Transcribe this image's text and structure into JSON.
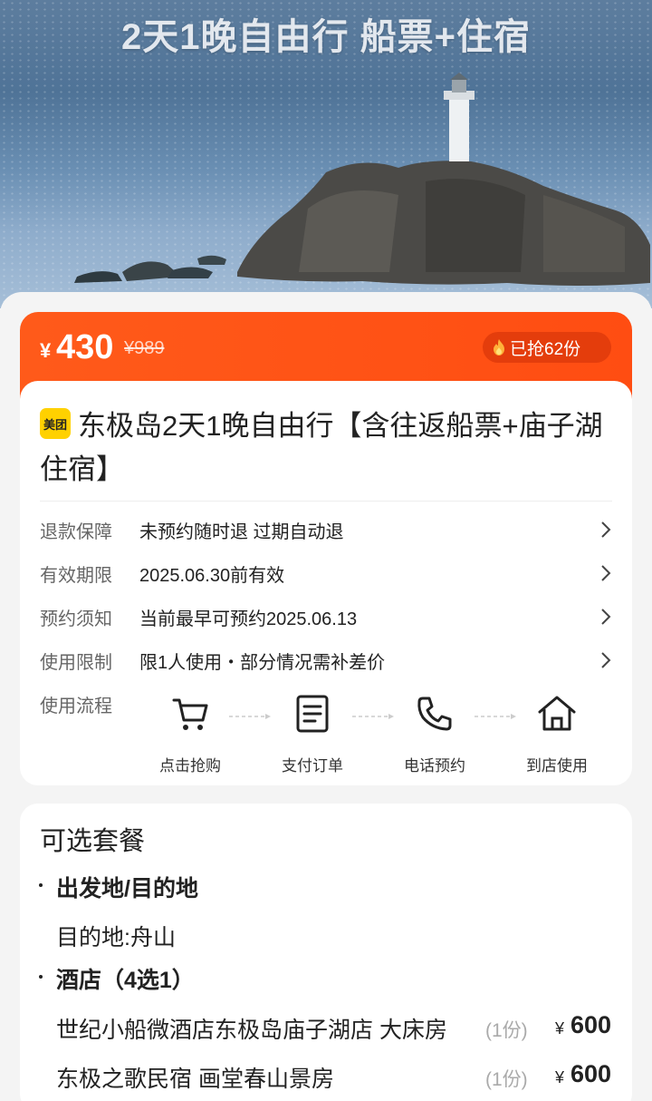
{
  "hero": {
    "title": "2天1晚自由行 船票+住宿"
  },
  "price": {
    "currency": "¥",
    "value": "430",
    "original": "¥989",
    "sold": "已抢62份"
  },
  "deal": {
    "brand_logo": "美团",
    "title": "东极岛2天1晚自由行【含往返船票+庙子湖住宿】"
  },
  "info_rows": [
    {
      "label": "退款保障",
      "value": "未预约随时退 过期自动退"
    },
    {
      "label": "有效期限",
      "value": "2025.06.30前有效"
    },
    {
      "label": "预约须知",
      "value": "当前最早可预约2025.06.13"
    },
    {
      "label": "使用限制",
      "value": "限1人使用・部分情况需补差价"
    }
  ],
  "flow": {
    "label": "使用流程",
    "steps": [
      {
        "label": "点击抢购",
        "icon": "cart-icon"
      },
      {
        "label": "支付订单",
        "icon": "document-icon"
      },
      {
        "label": "电话预约",
        "icon": "phone-icon"
      },
      {
        "label": "到店使用",
        "icon": "home-icon"
      }
    ]
  },
  "packages": {
    "heading": "可选套餐",
    "origin_title": "出发地/目的地",
    "destination": "目的地:舟山",
    "hotel_title": "酒店（4选1）",
    "options": [
      {
        "name": "世纪小船微酒店东极岛庙子湖店 大床房",
        "qty": "(1份)",
        "currency": "¥",
        "price": "600"
      },
      {
        "name": "东极之歌民宿 画堂春山景房",
        "qty": "(1份)",
        "currency": "¥",
        "price": "600"
      }
    ]
  },
  "colors": {
    "accent": "#ff4d12",
    "pill": "#e43d0c",
    "brand_yellow": "#ffd100"
  }
}
